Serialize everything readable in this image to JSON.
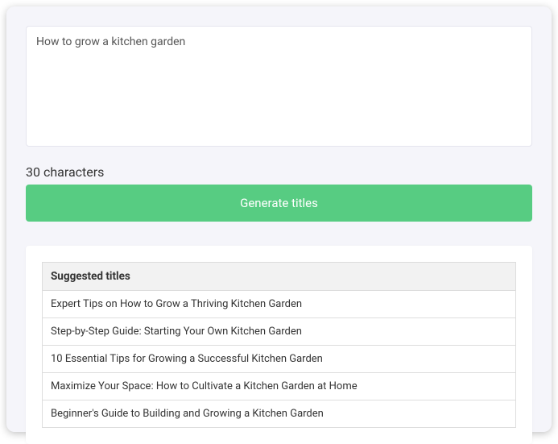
{
  "input": {
    "value": "How to grow a kitchen garden"
  },
  "charCount": "30 characters",
  "generateButton": "Generate titles",
  "results": {
    "header": "Suggested titles",
    "items": [
      "Expert Tips on How to Grow a Thriving Kitchen Garden",
      "Step-by-Step Guide: Starting Your Own Kitchen Garden",
      "10 Essential Tips for Growing a Successful Kitchen Garden",
      "Maximize Your Space: How to Cultivate a Kitchen Garden at Home",
      "Beginner's Guide to Building and Growing a Kitchen Garden"
    ]
  }
}
